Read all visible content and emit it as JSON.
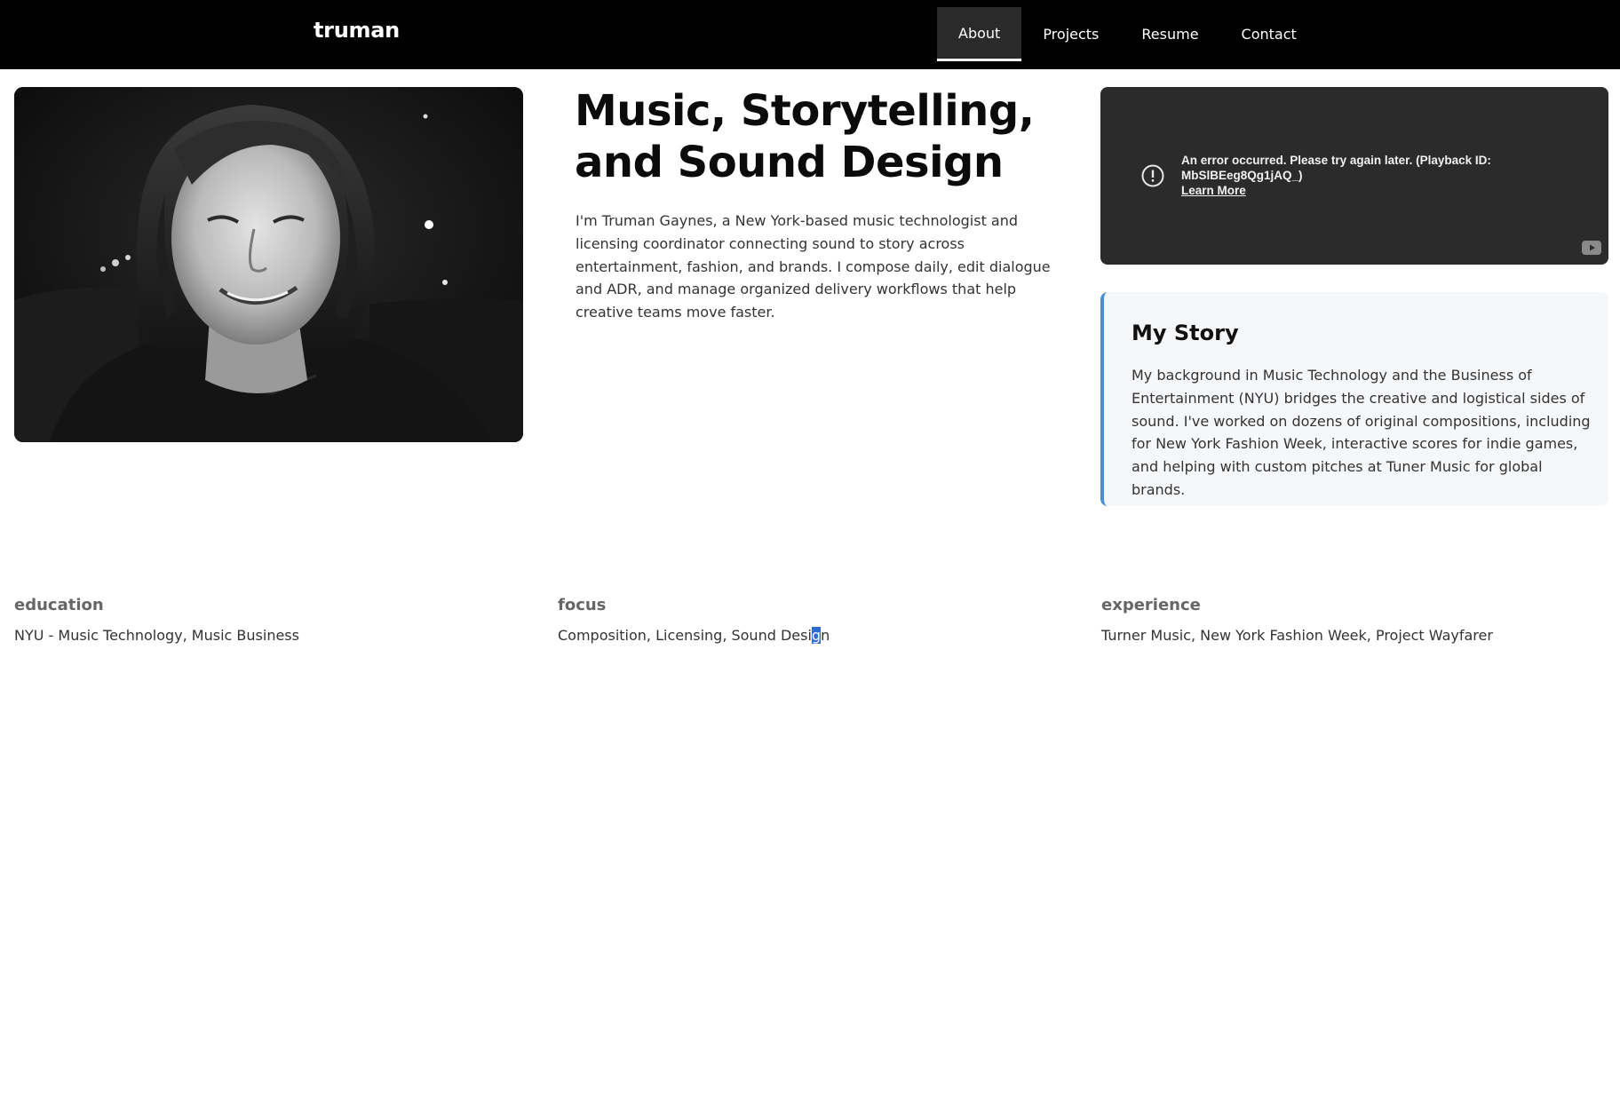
{
  "nav": {
    "brand": "truman",
    "links": [
      {
        "label": "About",
        "active": true
      },
      {
        "label": "Projects",
        "active": false
      },
      {
        "label": "Resume",
        "active": false
      },
      {
        "label": "Contact",
        "active": false
      }
    ]
  },
  "hero": {
    "title_line1": "Music, Storytelling,",
    "title_line2": "and Sound Design",
    "intro": "I'm Truman Gaynes, a New York-based music technologist and licensing coordinator connecting sound to story across entertainment, fashion, and brands. I compose daily, edit dialogue and ADR, and manage organized delivery workflows that help creative teams move faster."
  },
  "video": {
    "error_message": "An error occurred. Please try again later. (Playback ID: MbSlBEeg8Qg1jAQ_)",
    "learn_more": "Learn More",
    "icons": {
      "error": "error-circle-icon",
      "brand": "youtube-icon"
    }
  },
  "story": {
    "title": "My Story",
    "text": "My background in Music Technology and the Business of Entertainment (NYU) bridges the creative and logistical sides of sound. I've worked on dozens of original compositions, including for New York Fashion Week, interactive scores for indie games, and helping with custom pitches at Tuner Music for global brands."
  },
  "info": {
    "education": {
      "label": "education",
      "value": "NYU - Music Technology, Music Business"
    },
    "focus": {
      "label": "focus",
      "value_before": "Composition, Licensing, Sound Desi",
      "value_selected": "g",
      "value_after": "n"
    },
    "experience": {
      "label": "experience",
      "value": "Turner Music, New York Fashion Week, Project Wayfarer"
    }
  },
  "colors": {
    "nav_bg": "#000000",
    "nav_active_bg": "#2a2a2a",
    "story_accent": "#4a90d9",
    "story_bg": "#f6f7f9",
    "video_bg": "#2b2b2b",
    "selection": "#2e6bd1"
  }
}
